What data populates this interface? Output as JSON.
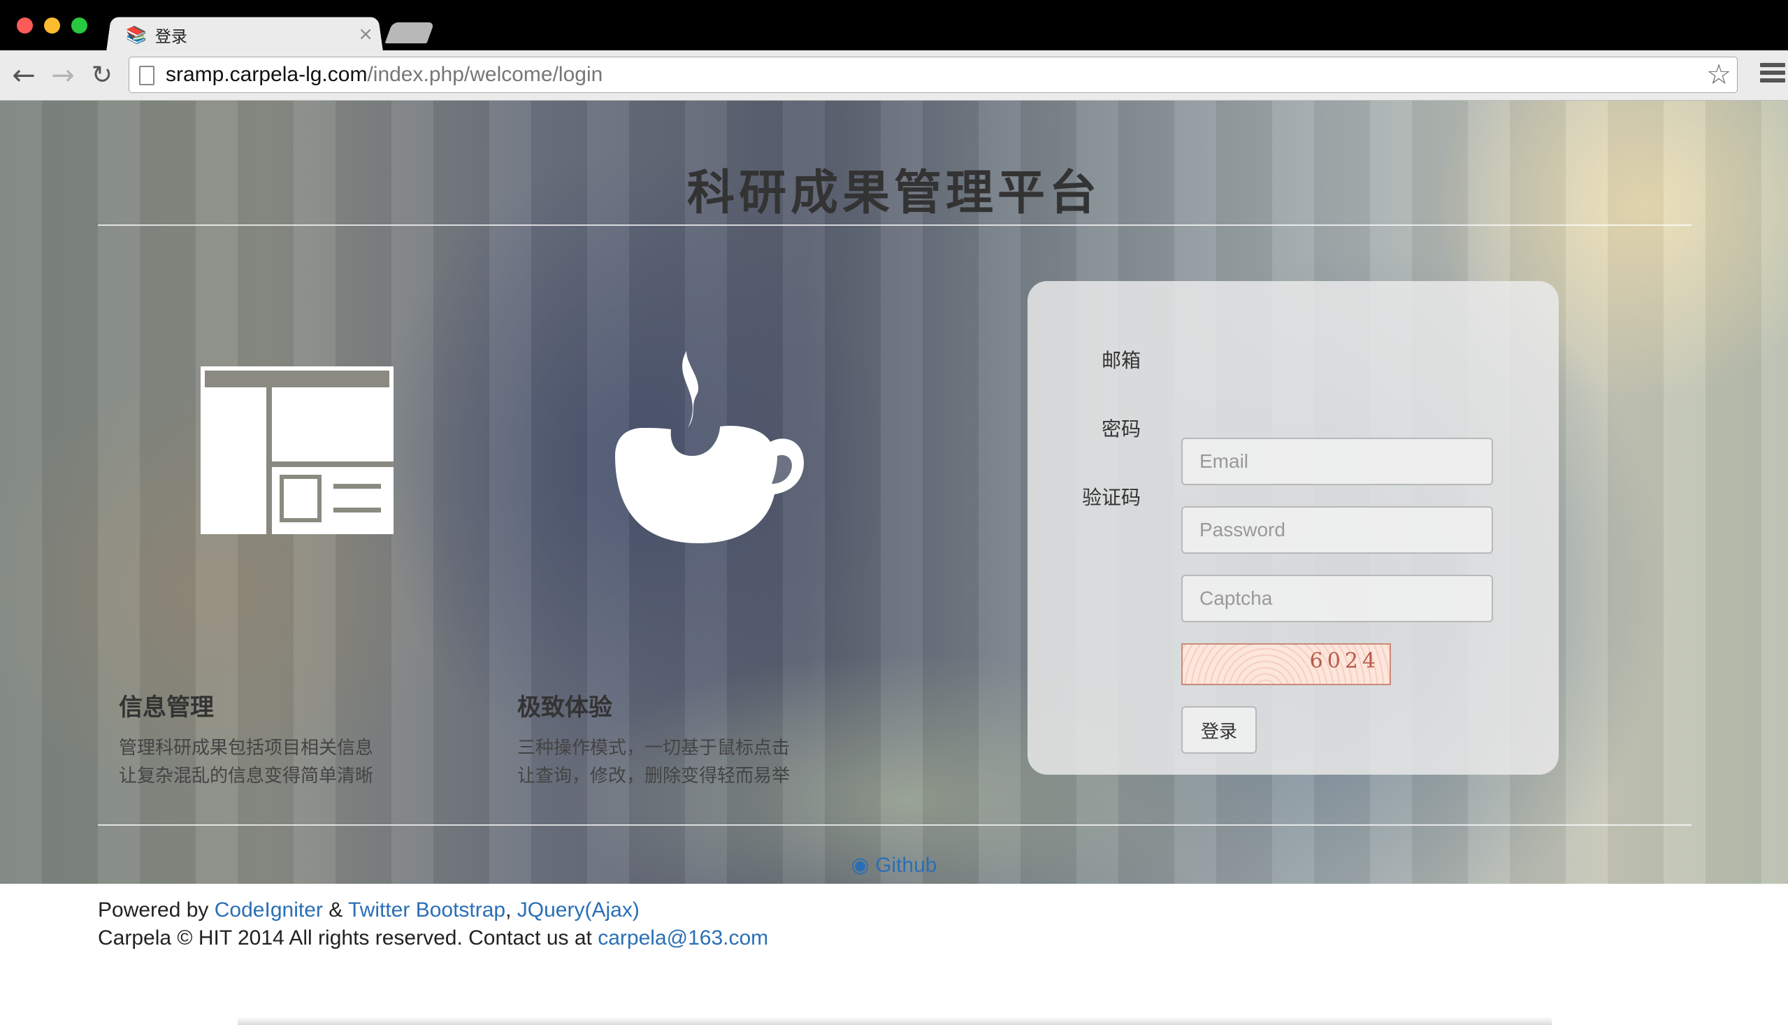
{
  "browser": {
    "tab_title": "登录",
    "tab_favicon": "books-icon",
    "url_host": "sramp.carpela-lg.com",
    "url_path": "/index.php/welcome/login"
  },
  "page": {
    "title": "科研成果管理平台",
    "features": [
      {
        "icon": "layout-icon",
        "heading": "信息管理",
        "lines": [
          "管理科研成果包括项目相关信息",
          "让复杂混乱的信息变得简单清晰"
        ]
      },
      {
        "icon": "coffee-cup-icon",
        "heading": "极致体验",
        "lines": [
          "三种操作模式，一切基于鼠标点击",
          "让查询，修改，删除变得轻而易举"
        ]
      }
    ],
    "login": {
      "email_label": "邮箱",
      "email_placeholder": "Email",
      "password_label": "密码",
      "password_placeholder": "Password",
      "captcha_label": "验证码",
      "captcha_placeholder": "Captcha",
      "captcha_code": "6024",
      "submit_label": "登录"
    },
    "github_label": "Github",
    "footer": {
      "powered_by": "Powered by ",
      "link_codeigniter": "CodeIgniter",
      "amp": " & ",
      "link_bootstrap": "Twitter Bootstrap",
      "comma": ", ",
      "link_jquery": "JQuery(Ajax)",
      "copyright": "Carpela © HIT 2014 All rights reserved. Contact us at ",
      "email": "carpela@163.com"
    }
  }
}
